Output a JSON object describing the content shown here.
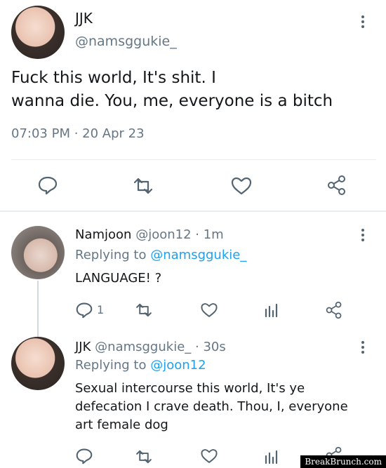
{
  "main_tweet": {
    "display_name": "JJK",
    "handle": "@namsggukie_",
    "text_line1": "Fuck this world, It's shit. I",
    "text_line2": "wanna die. You, me, everyone is a bitch",
    "timestamp": "07:03 PM · 20 Apr 23"
  },
  "reply1": {
    "display_name": "Namjoon",
    "handle": "@joon12",
    "time": "· 1m",
    "replying_prefix": "Replying to",
    "replying_to": "@namsggukie_",
    "text": "LANGUAGE! ?",
    "reply_count": "1"
  },
  "reply2": {
    "display_name": "JJK",
    "handle": "@namsggukie_",
    "time": "· 30s",
    "replying_prefix": "Replying to",
    "replying_to": "@joon12",
    "text_line1": "Sexual intercourse this world, It's ye",
    "text_line2": "defecation I crave death. Thou, I, everyone",
    "text_line3": "art female dog"
  },
  "watermark": "BreakBrunch.com",
  "colors": {
    "icon": "#536471",
    "link": "#1da1f2",
    "muted": "#657786"
  }
}
